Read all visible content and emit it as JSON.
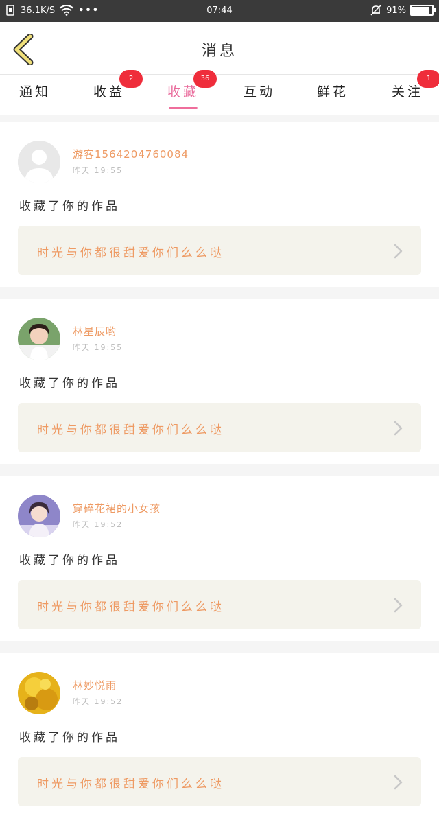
{
  "status_bar": {
    "speed": "36.1K/S",
    "dots": "•••",
    "time": "07:44",
    "battery_percent": "91%",
    "battery_level": 0.91
  },
  "header": {
    "title": "消息",
    "back_icon": "chevron-left-icon"
  },
  "tabs": [
    {
      "label": "通知",
      "badge": ""
    },
    {
      "label": "收益",
      "badge": "2"
    },
    {
      "label": "收藏",
      "badge": "36",
      "active": true
    },
    {
      "label": "互动",
      "badge": ""
    },
    {
      "label": "鲜花",
      "badge": ""
    },
    {
      "label": "关注",
      "badge": "1"
    }
  ],
  "colors": {
    "accent_pink": "#ef6e9c",
    "username_orange": "#ee9a63",
    "badge_red": "#ef2d3b"
  },
  "messages": [
    {
      "username": "游客1564204760084",
      "time": "昨天 19:55",
      "action": "收藏了你的作品",
      "work_title": "时光与你都很甜爱你们么么哒",
      "avatar": "default-avatar"
    },
    {
      "username": "林星辰哟",
      "time": "昨天 19:55",
      "action": "收藏了你的作品",
      "work_title": "时光与你都很甜爱你们么么哒",
      "avatar": "photo-avatar"
    },
    {
      "username": "穿碎花裙的小女孩",
      "time": "昨天 19:52",
      "action": "收藏了你的作品",
      "work_title": "时光与你都很甜爱你们么么哒",
      "avatar": "photo-avatar"
    },
    {
      "username": "林妙悦雨",
      "time": "昨天 19:52",
      "action": "收藏了你的作品",
      "work_title": "时光与你都很甜爱你们么么哒",
      "avatar": "photo-avatar"
    }
  ]
}
